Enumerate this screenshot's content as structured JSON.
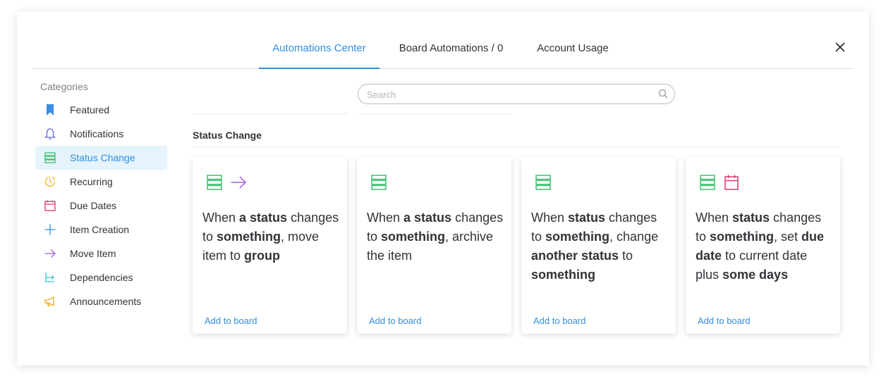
{
  "tabs": [
    {
      "label": "Automations Center",
      "active": true
    },
    {
      "label": "Board Automations / 0",
      "active": false
    },
    {
      "label": "Account Usage",
      "active": false
    }
  ],
  "sidebar": {
    "title": "Categories",
    "items": [
      {
        "label": "Featured",
        "icon": "bookmark-icon",
        "color": "#3b8de8"
      },
      {
        "label": "Notifications",
        "icon": "bell-icon",
        "color": "#6a6cd8"
      },
      {
        "label": "Status Change",
        "icon": "status-icon",
        "color": "#3fbf6e",
        "active": true
      },
      {
        "label": "Recurring",
        "icon": "clock-icon",
        "color": "#f5b324"
      },
      {
        "label": "Due Dates",
        "icon": "calendar-icon",
        "color": "#e0366f"
      },
      {
        "label": "Item Creation",
        "icon": "plus-icon",
        "color": "#2f8fe0"
      },
      {
        "label": "Move Item",
        "icon": "arrow-right-icon",
        "color": "#a25ddc"
      },
      {
        "label": "Dependencies",
        "icon": "dependency-icon",
        "color": "#3bbfcf"
      },
      {
        "label": "Announcements",
        "icon": "megaphone-icon",
        "color": "#f5a623"
      }
    ]
  },
  "search": {
    "placeholder": "Search",
    "value": ""
  },
  "section": {
    "title": "Status Change"
  },
  "cards": [
    {
      "icons": [
        "status-icon",
        "arrow-right-icon"
      ],
      "text": [
        [
          "When "
        ],
        [
          "a status",
          "b"
        ],
        [
          " changes to "
        ],
        [
          "something",
          "b"
        ],
        [
          ", move item to "
        ],
        [
          "group",
          "b"
        ]
      ],
      "link": "Add to board"
    },
    {
      "icons": [
        "status-icon"
      ],
      "text": [
        [
          "When "
        ],
        [
          "a status",
          "b"
        ],
        [
          " changes to "
        ],
        [
          "something",
          "b"
        ],
        [
          ", archive the item"
        ]
      ],
      "link": "Add to board"
    },
    {
      "icons": [
        "status-icon"
      ],
      "text": [
        [
          "When "
        ],
        [
          "status",
          "b"
        ],
        [
          " changes to "
        ],
        [
          "something",
          "b"
        ],
        [
          ", change "
        ],
        [
          "another status",
          "b"
        ],
        [
          " to "
        ],
        [
          "something",
          "b"
        ]
      ],
      "link": "Add to board"
    },
    {
      "icons": [
        "status-icon",
        "calendar-icon"
      ],
      "text": [
        [
          "When "
        ],
        [
          "status",
          "b"
        ],
        [
          " changes to "
        ],
        [
          "something",
          "b"
        ],
        [
          ", set "
        ],
        [
          "due date",
          "b"
        ],
        [
          " to current date plus "
        ],
        [
          "some days",
          "b"
        ]
      ],
      "link": "Add to board"
    }
  ],
  "colors": {
    "accent": "#2f8fe0",
    "status_green": "#3fbf6e",
    "calendar_red": "#e0366f",
    "arrow_purple": "#a25ddc"
  }
}
